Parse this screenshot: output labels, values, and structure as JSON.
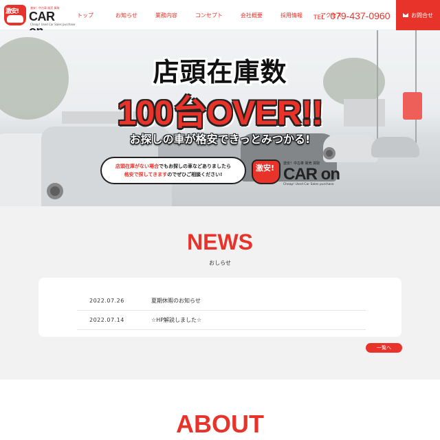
{
  "header": {
    "logo": {
      "badge": "激安!",
      "name": "CAR on",
      "sub": "激安！中古車 販売 買取",
      "tag": "Cheap! Used Car Sales purchase"
    },
    "nav": [
      "トップ",
      "お知らせ",
      "業務内容",
      "コンセプト",
      "会社概要",
      "採用情報",
      "アクセス"
    ],
    "tel_label": "TEL",
    "tel_number": "079-437-0960",
    "contact_label": "お問合せ"
  },
  "hero": {
    "headline1": "店頭在庫数",
    "headline2": "100台OVER!!",
    "headline3": "お探しの車が格安できっとみつかる!",
    "bubble_line1_red": "店頭在庫がない場合",
    "bubble_line1_rest": "でもお探しの車などありましたら",
    "bubble_line2_red": "格安で探してきます",
    "bubble_line2_rest": "のでぜひご相談ください!",
    "logo": {
      "badge": "激安!",
      "name": "CAR on",
      "sub": "激安！中古車 販売 買取",
      "tag": "Cheap! Used Car Sales purchase"
    }
  },
  "news": {
    "title": "NEWS",
    "subtitle": "おしらせ",
    "items": [
      {
        "date": "2022.07.26",
        "text": "夏期休暇のお知らせ"
      },
      {
        "date": "2022.07.14",
        "text": "☆HP解説しました☆"
      }
    ],
    "more_label": "一覧へ"
  },
  "about": {
    "title": "ABOUT"
  },
  "colors": {
    "accent": "#e8332a",
    "text": "#333333",
    "background": "#f2f2f2"
  }
}
